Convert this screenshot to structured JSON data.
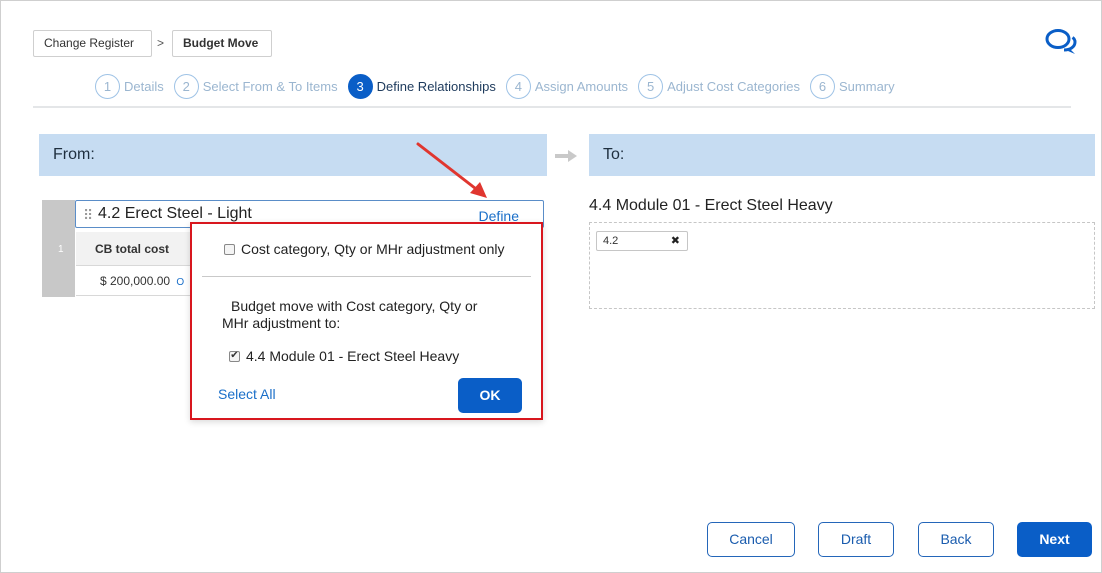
{
  "breadcrumb": {
    "items": [
      "Change Register",
      "Budget Move"
    ],
    "separator": ">"
  },
  "header": {
    "chat_icon": "chat-bubbles-icon"
  },
  "steps": [
    {
      "number": "1",
      "label": "Details",
      "active": false
    },
    {
      "number": "2",
      "label": "Select From & To Items",
      "active": false
    },
    {
      "number": "3",
      "label": "Define Relationships",
      "active": true
    },
    {
      "number": "4",
      "label": "Assign Amounts",
      "active": false
    },
    {
      "number": "5",
      "label": "Adjust Cost Categories",
      "active": false
    },
    {
      "number": "6",
      "label": "Summary",
      "active": false
    }
  ],
  "from_panel": {
    "title": "From:",
    "row_number": "1",
    "item": {
      "drag_handle": "⠿",
      "title": "4.2 Erect Steel - Light",
      "define_link": "Define"
    },
    "column_header": "CB total cost",
    "column_value": "$ 200,000.00",
    "column_value_suffix": "O"
  },
  "to_panel": {
    "title": "To:",
    "item_title": "4.4 Module 01 - Erect Steel Heavy",
    "tag": {
      "label": "4.2",
      "remove": "✖"
    }
  },
  "popup": {
    "option_adjust_only": {
      "label": "Cost category, Qty or MHr adjustment only",
      "checked": false
    },
    "description_line1": "Budget move with Cost category, Qty or",
    "description_line2": "MHr adjustment to:",
    "option_target": {
      "label": "4.4 Module 01 - Erect Steel Heavy",
      "checked": true
    },
    "select_all": "Select All",
    "ok": "OK"
  },
  "footer": {
    "cancel": "Cancel",
    "draft": "Draft",
    "back": "Back",
    "next": "Next"
  },
  "colors": {
    "primary": "#0a5ec7",
    "panel_header": "#c6dcf2",
    "highlight": "#d8161e",
    "link": "#1a6fc9"
  }
}
